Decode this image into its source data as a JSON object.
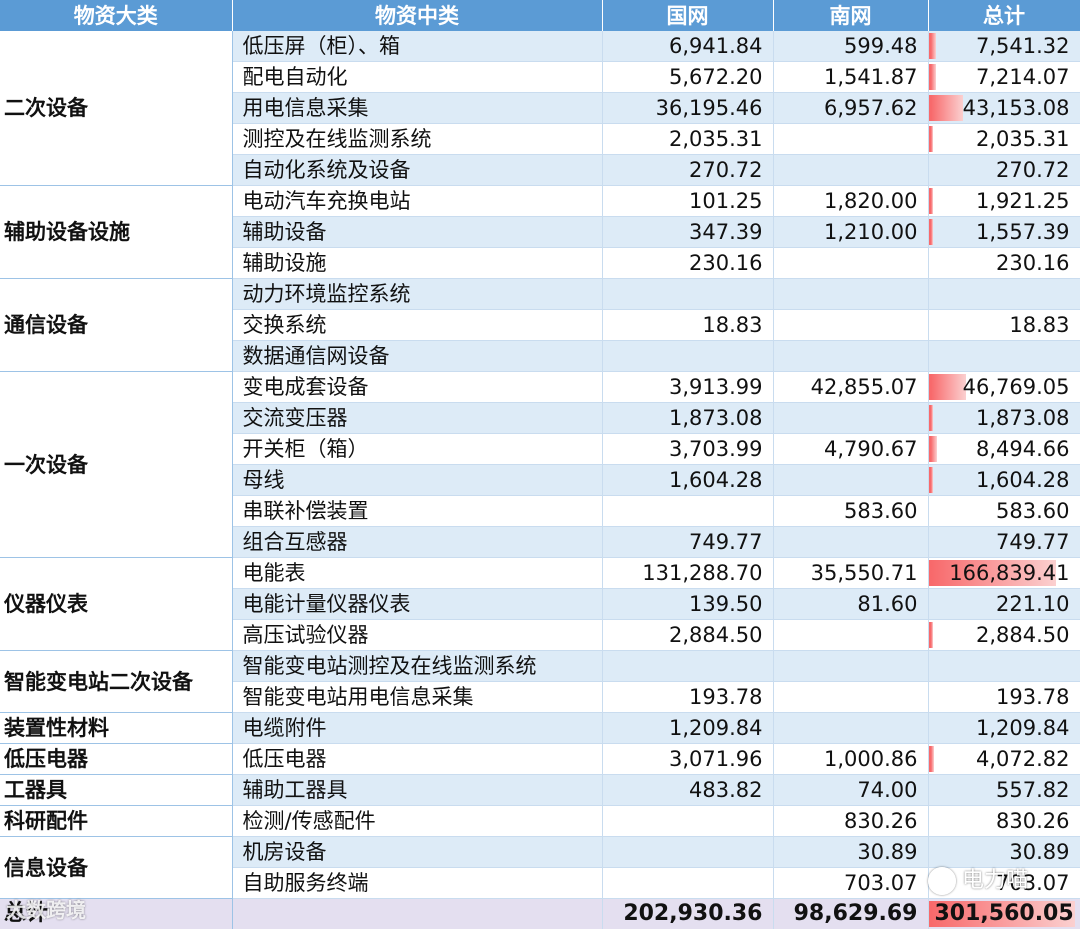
{
  "headers": {
    "category": "物资大类",
    "subcategory": "物资中类",
    "sgcc": "国网",
    "csg": "南网",
    "total": "总计"
  },
  "bar_color": "#f8696b",
  "header_color": "#5b9bd5",
  "band_color": "#ddebf7",
  "total_row": {
    "label": "总计",
    "sgcc": "202,930.36",
    "csg": "98,629.69",
    "total": "301,560.05",
    "bar_fraction": 1.0
  },
  "watermarks": {
    "left": "大数跨境",
    "right": "电力喵"
  },
  "rows": [
    {
      "category": "二次设备",
      "span": 5,
      "sub": "低压屏（柜）、箱",
      "sgcc": "6,941.84",
      "csg": "599.48",
      "total": "7,541.32",
      "bar": 0.045
    },
    {
      "sub": "配电自动化",
      "sgcc": "5,672.20",
      "csg": "1,541.87",
      "total": "7,214.07",
      "bar": 0.043
    },
    {
      "sub": "用电信息采集",
      "sgcc": "36,195.46",
      "csg": "6,957.62",
      "total": "43,153.08",
      "bar": 0.259
    },
    {
      "sub": "测控及在线监测系统",
      "sgcc": "2,035.31",
      "csg": "",
      "total": "2,035.31",
      "bar": 0.012
    },
    {
      "sub": "自动化系统及设备",
      "sgcc": "270.72",
      "csg": "",
      "total": "270.72",
      "bar": 0.0
    },
    {
      "category": "辅助设备设施",
      "span": 3,
      "sub": "电动汽车充换电站",
      "sgcc": "101.25",
      "csg": "1,820.00",
      "total": "1,921.25",
      "bar": 0.012
    },
    {
      "sub": "辅助设备",
      "sgcc": "347.39",
      "csg": "1,210.00",
      "total": "1,557.39",
      "bar": 0.009
    },
    {
      "sub": "辅助设施",
      "sgcc": "230.16",
      "csg": "",
      "total": "230.16",
      "bar": 0.0
    },
    {
      "category": "通信设备",
      "span": 3,
      "sub": "动力环境监控系统",
      "sgcc": "",
      "csg": "",
      "total": "",
      "bar": 0.0
    },
    {
      "sub": "交换系统",
      "sgcc": "18.83",
      "csg": "",
      "total": "18.83",
      "bar": 0.0
    },
    {
      "sub": "数据通信网设备",
      "sgcc": "",
      "csg": "",
      "total": "",
      "bar": 0.0
    },
    {
      "category": "一次设备",
      "span": 6,
      "sub": "变电成套设备",
      "sgcc": "3,913.99",
      "csg": "42,855.07",
      "total": "46,769.05",
      "bar": 0.28
    },
    {
      "sub": "交流变压器",
      "sgcc": "1,873.08",
      "csg": "",
      "total": "1,873.08",
      "bar": 0.011
    },
    {
      "sub": "开关柜（箱）",
      "sgcc": "3,703.99",
      "csg": "4,790.67",
      "total": "8,494.66",
      "bar": 0.051
    },
    {
      "sub": "母线",
      "sgcc": "1,604.28",
      "csg": "",
      "total": "1,604.28",
      "bar": 0.01
    },
    {
      "sub": "串联补偿装置",
      "sgcc": "",
      "csg": "583.60",
      "total": "583.60",
      "bar": 0.0
    },
    {
      "sub": "组合互感器",
      "sgcc": "749.77",
      "csg": "",
      "total": "749.77",
      "bar": 0.0
    },
    {
      "category": "仪器仪表",
      "span": 3,
      "sub": "电能表",
      "sgcc": "131,288.70",
      "csg": "35,550.71",
      "total": "166,839.41",
      "bar": 1.0
    },
    {
      "sub": "电能计量仪器仪表",
      "sgcc": "139.50",
      "csg": "81.60",
      "total": "221.10",
      "bar": 0.0
    },
    {
      "sub": "高压试验仪器",
      "sgcc": "2,884.50",
      "csg": "",
      "total": "2,884.50",
      "bar": 0.017
    },
    {
      "category": "智能变电站二次设备",
      "span": 2,
      "sub": "智能变电站测控及在线监测系统",
      "sgcc": "",
      "csg": "",
      "total": "",
      "bar": 0.0
    },
    {
      "sub": "智能变电站用电信息采集",
      "sgcc": "193.78",
      "csg": "",
      "total": "193.78",
      "bar": 0.0
    },
    {
      "category": "装置性材料",
      "span": 1,
      "sub": "电缆附件",
      "sgcc": "1,209.84",
      "csg": "",
      "total": "1,209.84",
      "bar": 0.0
    },
    {
      "category": "低压电器",
      "span": 1,
      "sub": "低压电器",
      "sgcc": "3,071.96",
      "csg": "1,000.86",
      "total": "4,072.82",
      "bar": 0.024
    },
    {
      "category": "工器具",
      "span": 1,
      "sub": "辅助工器具",
      "sgcc": "483.82",
      "csg": "74.00",
      "total": "557.82",
      "bar": 0.0
    },
    {
      "category": "科研配件",
      "span": 1,
      "sub": "检测/传感配件",
      "sgcc": "",
      "csg": "830.26",
      "total": "830.26",
      "bar": 0.0
    },
    {
      "category": "信息设备",
      "span": 2,
      "sub": "机房设备",
      "sgcc": "",
      "csg": "30.89",
      "total": "30.89",
      "bar": 0.0
    },
    {
      "sub": "自助服务终端",
      "sgcc": "",
      "csg": "703.07",
      "total": "703.07",
      "bar": 0.0
    }
  ]
}
